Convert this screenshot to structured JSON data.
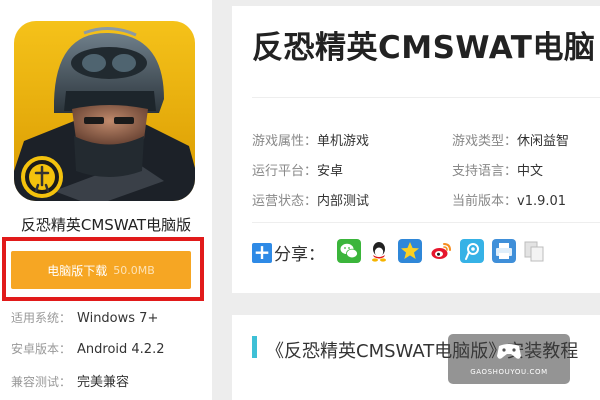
{
  "game": {
    "title": "反恐精英CMSWAT电脑版",
    "download_label": "电脑版下载",
    "download_size": "50.0MB",
    "info": [
      {
        "key": "适用系统：",
        "value": "Windows 7+"
      },
      {
        "key": "安卓版本：",
        "value": "Android 4.2.2"
      },
      {
        "key": "兼容测试：",
        "value": "完美兼容"
      }
    ]
  },
  "header": {
    "title": "反恐精英CMSWAT电脑"
  },
  "attributes": [
    {
      "key": "游戏属性：",
      "value": "单机游戏"
    },
    {
      "key": "游戏类型：",
      "value": "休闲益智"
    },
    {
      "key": "运行平台：",
      "value": "安卓"
    },
    {
      "key": "支持语言：",
      "value": "中文"
    },
    {
      "key": "运营状态：",
      "value": "内部测试"
    },
    {
      "key": "当前版本：",
      "value": "v1.9.01"
    }
  ],
  "share": {
    "label": "分享：",
    "icons": [
      "wechat-icon",
      "qq-icon",
      "qzone-icon",
      "weibo-icon",
      "tencent-weibo-icon",
      "print-icon",
      "copy-icon"
    ]
  },
  "article": {
    "title": "《反恐精英CMSWAT电脑版》安装教程"
  },
  "watermark": {
    "text": "GAOSHOUYOU.COM"
  },
  "colors": {
    "download_button": "#f6a623",
    "highlight_frame": "#e11a1a",
    "accent_bar": "#3ec0d6",
    "share_plus": "#2e8ae6"
  }
}
